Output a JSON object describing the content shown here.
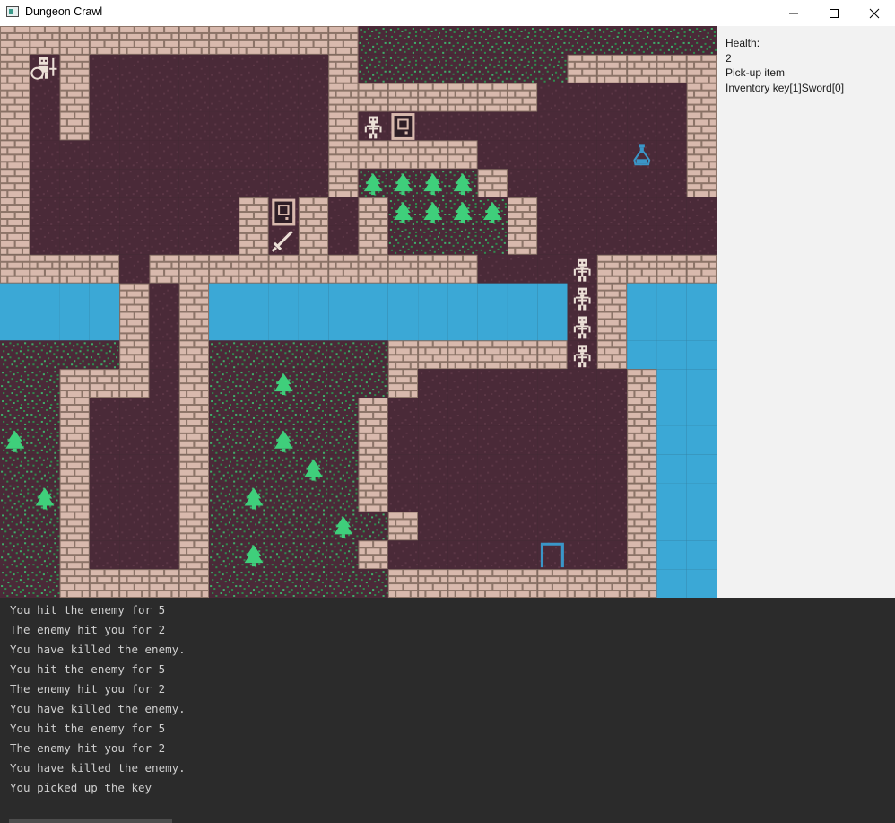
{
  "window": {
    "title": "Dungeon Crawl",
    "controls": {
      "minimize": "—",
      "maximize": "☐",
      "close": "✕"
    }
  },
  "status": {
    "health_label": "Health:",
    "health_value": "2",
    "pickup_label": "Pick-up item",
    "inventory": "Inventory key[1]Sword[0]"
  },
  "log": [
    "You hit the enemy for 5",
    "The enemy hit you for 2",
    "You have killed the enemy.",
    "You hit the enemy for 5",
    "The enemy hit you for 2",
    "You have killed the enemy.",
    "You hit the enemy for 5",
    "The enemy hit you for 2",
    "You have killed the enemy.",
    "You picked up the key"
  ],
  "map": {
    "legend": {
      "#": "brick-wall",
      ".": "dungeon-floor",
      "g": "grass",
      "w": "water",
      "t": "tree",
      "s": "skeleton-enemy",
      "p": "player-with-shield",
      "d": "closed-door",
      "o": "open-door",
      "k": "sword-item",
      "v": "potion-item"
    },
    "rows": [
      "############gggggggggggg",
      "#p#........#ggggggg#####",
      "#.#........#######.....#",
      "#.#........#sd.........#",
      "#..........#####.....v.#",
      "#..........#tttt#......#",
      "#.......#d#.#tttt#......#",
      "#.......#k#.#gggg#......#",
      "####.###########...s####",
      "wwww#.#wwwwwwwwwwwws#www",
      "wwww#.#wwwwwwwwwwwws#www",
      "gggg#.#gggggg######s#www",
      "gg###.#ggtggg#.......#www",
      "gg#...#ggggg#........#www",
      "tg#...#ggtgg#........#www",
      "gg#...#gggtg#........#www",
      "gt#...#gtggg#........#www",
      "gg#...#ggggtg#.......#www",
      "gg#...#gtggg#.....o..#www",
      "gg#####gggggg#########www"
    ],
    "colors": {
      "floor": "#4a2a38",
      "brick": "#d8b9ad",
      "water": "#3ba8d6",
      "grass": "#2f8a4d",
      "tree": "#3fcf7b",
      "skeleton": "#ece0d7",
      "potion": "#3a96c8"
    }
  }
}
